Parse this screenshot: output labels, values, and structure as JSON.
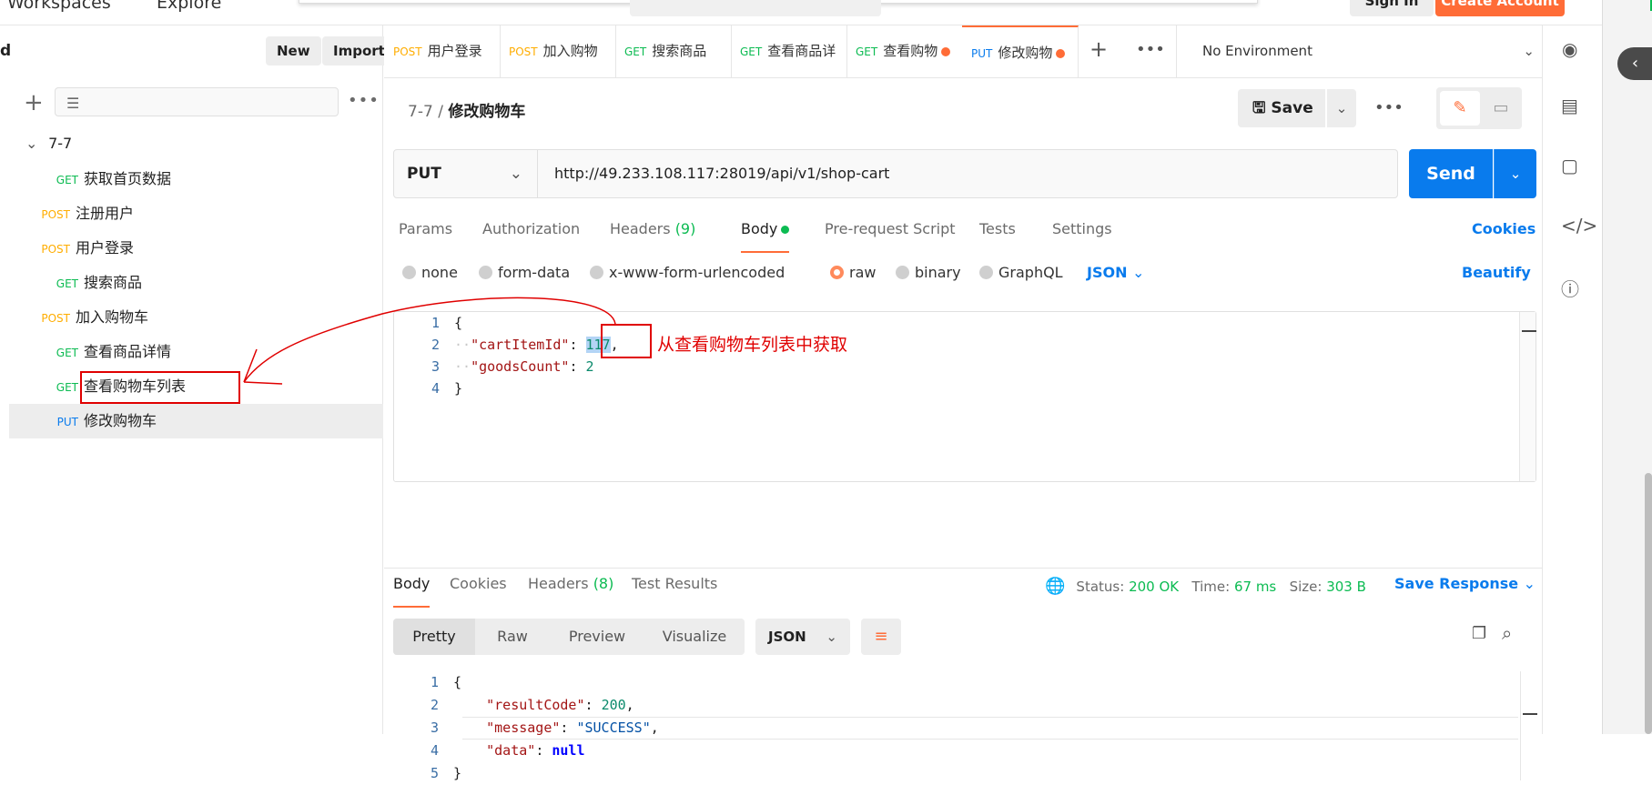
{
  "topbar": {
    "workspaces": "Workspaces",
    "explore": "Explore",
    "signin": "Sign In",
    "create_account": "Create Account"
  },
  "sidebar": {
    "title": "d",
    "new_label": "New",
    "import_label": "Import",
    "folder": "7-7",
    "items": [
      {
        "method": "GET",
        "name": "获取首页数据"
      },
      {
        "method": "POST",
        "name": "注册用户"
      },
      {
        "method": "POST",
        "name": "用户登录"
      },
      {
        "method": "GET",
        "name": "搜索商品"
      },
      {
        "method": "POST",
        "name": "加入购物车"
      },
      {
        "method": "GET",
        "name": "查看商品详情"
      },
      {
        "method": "GET",
        "name": "查看购物车列表"
      },
      {
        "method": "PUT",
        "name": "修改购物车"
      }
    ]
  },
  "tabs": [
    {
      "method": "POST",
      "label": "用户登录"
    },
    {
      "method": "POST",
      "label": "加入购物"
    },
    {
      "method": "GET",
      "label": "搜索商品"
    },
    {
      "method": "GET",
      "label": "查看商品详"
    },
    {
      "method": "GET",
      "label": "查看购物"
    },
    {
      "method": "PUT",
      "label": "修改购物"
    }
  ],
  "environment": "No Environment",
  "request": {
    "breadcrumb_parent": "7-7",
    "breadcrumb_sep": "/",
    "breadcrumb_current": "修改购物车",
    "save_label": "Save",
    "method": "PUT",
    "url": "http://49.233.108.117:28019/api/v1/shop-cart",
    "send_label": "Send",
    "tabs": {
      "params": "Params",
      "authorization": "Authorization",
      "headers": "Headers",
      "headers_count": "(9)",
      "body": "Body",
      "prerequest": "Pre-request Script",
      "tests": "Tests",
      "settings": "Settings"
    },
    "cookies_label": "Cookies",
    "body_types": {
      "none": "none",
      "form_data": "form-data",
      "urlencoded": "x-www-form-urlencoded",
      "raw": "raw",
      "binary": "binary",
      "graphql": "GraphQL",
      "format": "JSON"
    },
    "beautify_label": "Beautify",
    "body_code": {
      "ln1": "1",
      "ln2": "2",
      "ln3": "3",
      "ln4": "4",
      "open": "{",
      "key1": "\"cartItemId\"",
      "colon": ":",
      "val1": "117",
      "comma": ",",
      "key2": "\"goodsCount\"",
      "val2": "2",
      "close": "}"
    }
  },
  "annotation": {
    "text": "从查看购物车列表中获取"
  },
  "response": {
    "tabs": {
      "body": "Body",
      "cookies": "Cookies",
      "headers": "Headers",
      "headers_count": "(8)",
      "test_results": "Test Results"
    },
    "status_label": "Status:",
    "status_value": "200 OK",
    "time_label": "Time:",
    "time_value": "67 ms",
    "size_label": "Size:",
    "size_value": "303 B",
    "save_response": "Save Response",
    "views": {
      "pretty": "Pretty",
      "raw": "Raw",
      "preview": "Preview",
      "visualize": "Visualize"
    },
    "format": "JSON",
    "code": {
      "ln1": "1",
      "ln2": "2",
      "ln3": "3",
      "ln4": "4",
      "ln5": "5",
      "open": "{",
      "k1": "\"resultCode\"",
      "v1": "200",
      "k2": "\"message\"",
      "v2": "\"SUCCESS\"",
      "k3": "\"data\"",
      "v3": "null",
      "close": "}"
    }
  },
  "colors": {
    "accent": "#ff6c37",
    "primary": "#097bed",
    "get": "#0cbb52",
    "post": "#ffad00",
    "put": "#097bed",
    "annotation": "#e00000"
  }
}
